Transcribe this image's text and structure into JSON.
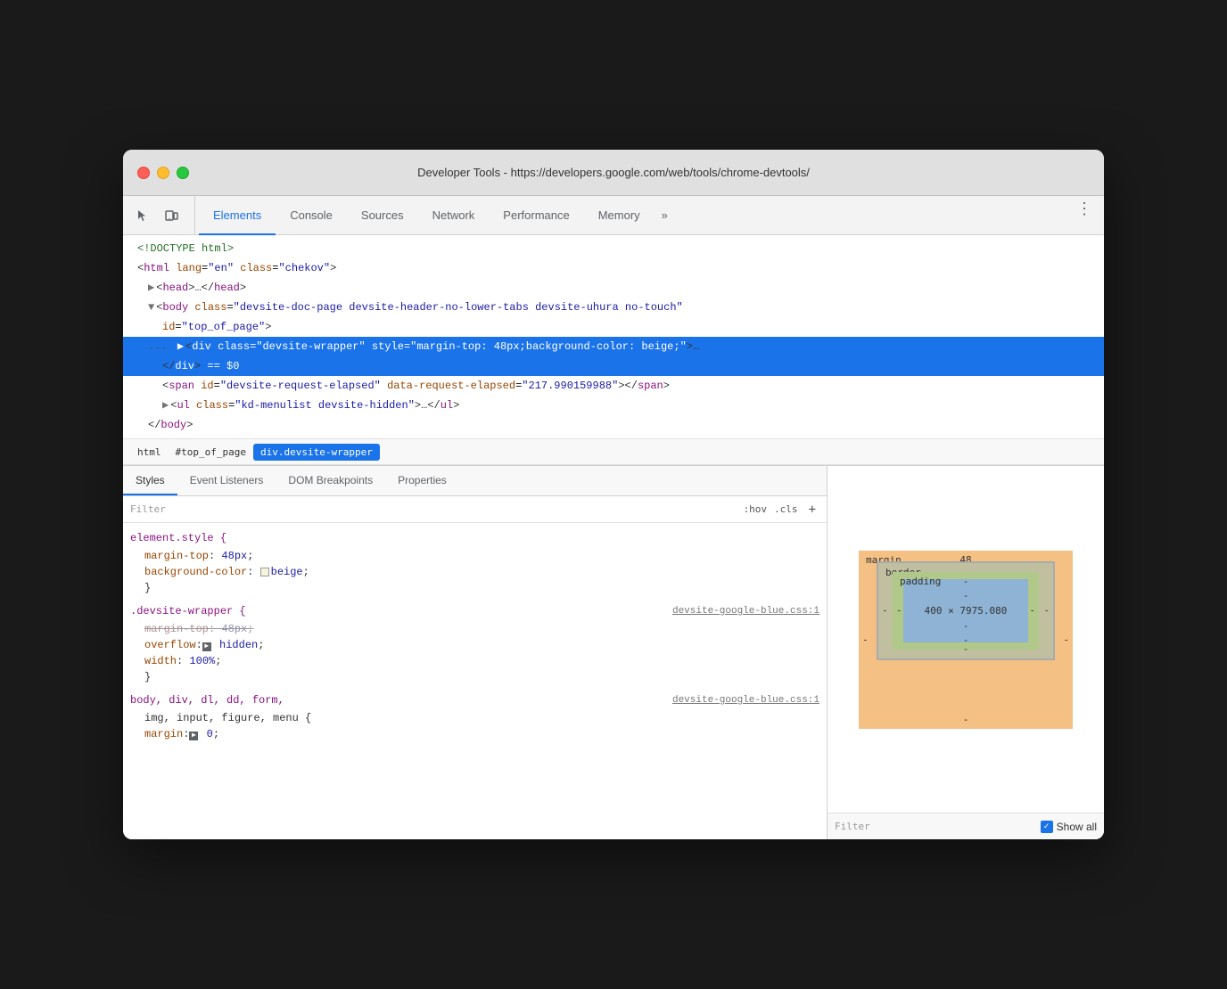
{
  "window": {
    "title": "Developer Tools - https://developers.google.com/web/tools/chrome-devtools/"
  },
  "toolbar": {
    "tabs": [
      {
        "id": "elements",
        "label": "Elements",
        "active": true
      },
      {
        "id": "console",
        "label": "Console",
        "active": false
      },
      {
        "id": "sources",
        "label": "Sources",
        "active": false
      },
      {
        "id": "network",
        "label": "Network",
        "active": false
      },
      {
        "id": "performance",
        "label": "Performance",
        "active": false
      },
      {
        "id": "memory",
        "label": "Memory",
        "active": false
      }
    ],
    "more_label": "»",
    "menu_label": "⋮"
  },
  "dom_tree": {
    "lines": [
      {
        "indent": 0,
        "content_html": "<span class='comment'>&lt;!DOCTYPE html&gt;</span>"
      },
      {
        "indent": 0,
        "content_html": "<span class='punctuation'>&lt;</span><span class='tag'>html</span> <span class='attr-name'>lang</span>=<span class='attr-value'>\"en\"</span> <span class='attr-name'>class</span>=<span class='attr-value'>\"chekov\"</span><span class='punctuation'>&gt;</span>"
      },
      {
        "indent": 1,
        "content_html": "<span class='triangle'>▶</span><span class='punctuation'>&lt;</span><span class='tag'>head</span><span class='punctuation'>&gt;</span><span class='ellipsis'>…</span><span class='punctuation'>&lt;/</span><span class='tag'>head</span><span class='punctuation'>&gt;</span>"
      },
      {
        "indent": 1,
        "content_html": "<span class='triangle'>▼</span><span class='punctuation'>&lt;</span><span class='tag'>body</span> <span class='attr-name'>class</span>=<span class='attr-value'>\"devsite-doc-page devsite-header-no-lower-tabs devsite-uhura no-touch\"</span>"
      },
      {
        "indent": 2,
        "content_html": "<span class='attr-name'>id</span>=<span class='attr-value'>\"top_of_page\"</span><span class='punctuation'>&gt;</span>"
      },
      {
        "indent": 1,
        "selected": true,
        "content_html": "<span class='dots'>...</span> <span class='triangle'>▶</span><span class='punctuation'>&lt;</span><span class='tag'>div</span> <span class='attr-name'>class</span>=<span class='attr-value'>\"devsite-wrapper\"</span> <span class='attr-name'>style</span>=<span class='attr-value'>\"margin-top: 48px;background-color: beige;\"</span><span class='punctuation'>&gt;</span><span class='ellipsis'>…</span>"
      },
      {
        "indent": 2,
        "selected": true,
        "content_html": "<span class='punctuation'>&lt;/</span><span class='tag'>div</span><span class='punctuation'>&gt;</span> <span class='equals-sign'>==</span> <span class='dollar-sign'>$0</span>"
      },
      {
        "indent": 2,
        "content_html": "<span class='punctuation'>&lt;</span><span class='tag'>span</span> <span class='attr-name'>id</span>=<span class='attr-value'>\"devsite-request-elapsed\"</span> <span class='attr-name'>data-request-elapsed</span>=<span class='attr-value'>\"217.990159988\"</span><span class='punctuation'>&gt;&lt;/</span><span class='tag'>span</span><span class='punctuation'>&gt;</span>"
      },
      {
        "indent": 2,
        "content_html": "<span class='triangle'>▶</span><span class='punctuation'>&lt;</span><span class='tag'>ul</span> <span class='attr-name'>class</span>=<span class='attr-value'>\"kd-menulist devsite-hidden\"</span><span class='punctuation'>&gt;</span><span class='ellipsis'>…</span><span class='punctuation'>&lt;/</span><span class='tag'>ul</span><span class='punctuation'>&gt;</span>"
      },
      {
        "indent": 1,
        "content_html": "<span class='punctuation'>&lt;/</span><span class='tag'>body</span><span class='punctuation'>&gt;</span>"
      }
    ]
  },
  "breadcrumb": {
    "items": [
      {
        "label": "html",
        "selected": false
      },
      {
        "label": "#top_of_page",
        "selected": false
      },
      {
        "label": "div.devsite-wrapper",
        "selected": true
      }
    ]
  },
  "sub_tabs": {
    "tabs": [
      {
        "id": "styles",
        "label": "Styles",
        "active": true
      },
      {
        "id": "event-listeners",
        "label": "Event Listeners",
        "active": false
      },
      {
        "id": "dom-breakpoints",
        "label": "DOM Breakpoints",
        "active": false
      },
      {
        "id": "properties",
        "label": "Properties",
        "active": false
      }
    ]
  },
  "filter": {
    "placeholder": "Filter",
    "hov_tag": ":hov",
    "cls_tag": ".cls",
    "add_label": "+"
  },
  "css_rules": [
    {
      "selector": "element.style {",
      "source": "",
      "properties": [
        {
          "name": "margin-top",
          "value": "48px",
          "strikethrough": false,
          "has_color": false
        },
        {
          "name": "background-color",
          "value": "beige",
          "strikethrough": false,
          "has_color": true
        }
      ]
    },
    {
      "selector": ".devsite-wrapper {",
      "source": "devsite-google-blue.css:1",
      "properties": [
        {
          "name": "margin-top",
          "value": "48px",
          "strikethrough": true,
          "has_color": false
        },
        {
          "name": "overflow",
          "value": "hidden",
          "strikethrough": false,
          "has_color": false,
          "has_arrow": true
        },
        {
          "name": "width",
          "value": "100%",
          "strikethrough": false,
          "has_color": false
        }
      ]
    },
    {
      "selector": "body, div, dl, dd, form,",
      "source": "devsite-google-blue.css:1",
      "properties": [
        {
          "name": "margin",
          "value": "0",
          "strikethrough": false,
          "has_color": false,
          "has_arrow": true,
          "partial": true
        }
      ]
    }
  ],
  "box_model": {
    "margin_label": "margin",
    "margin_top": "48",
    "margin_left": "-",
    "margin_right": "-",
    "margin_bottom": "-",
    "border_label": "border",
    "border_value": "-",
    "padding_label": "padding",
    "padding_value": "-",
    "content_width": "400",
    "content_height": "7975.080",
    "content_dimensions": "400 × 7975.080",
    "content_padding_bottom": "-",
    "content_margin_bottom": "-"
  },
  "computed": {
    "filter_placeholder": "Filter",
    "show_all_label": "Show all"
  }
}
